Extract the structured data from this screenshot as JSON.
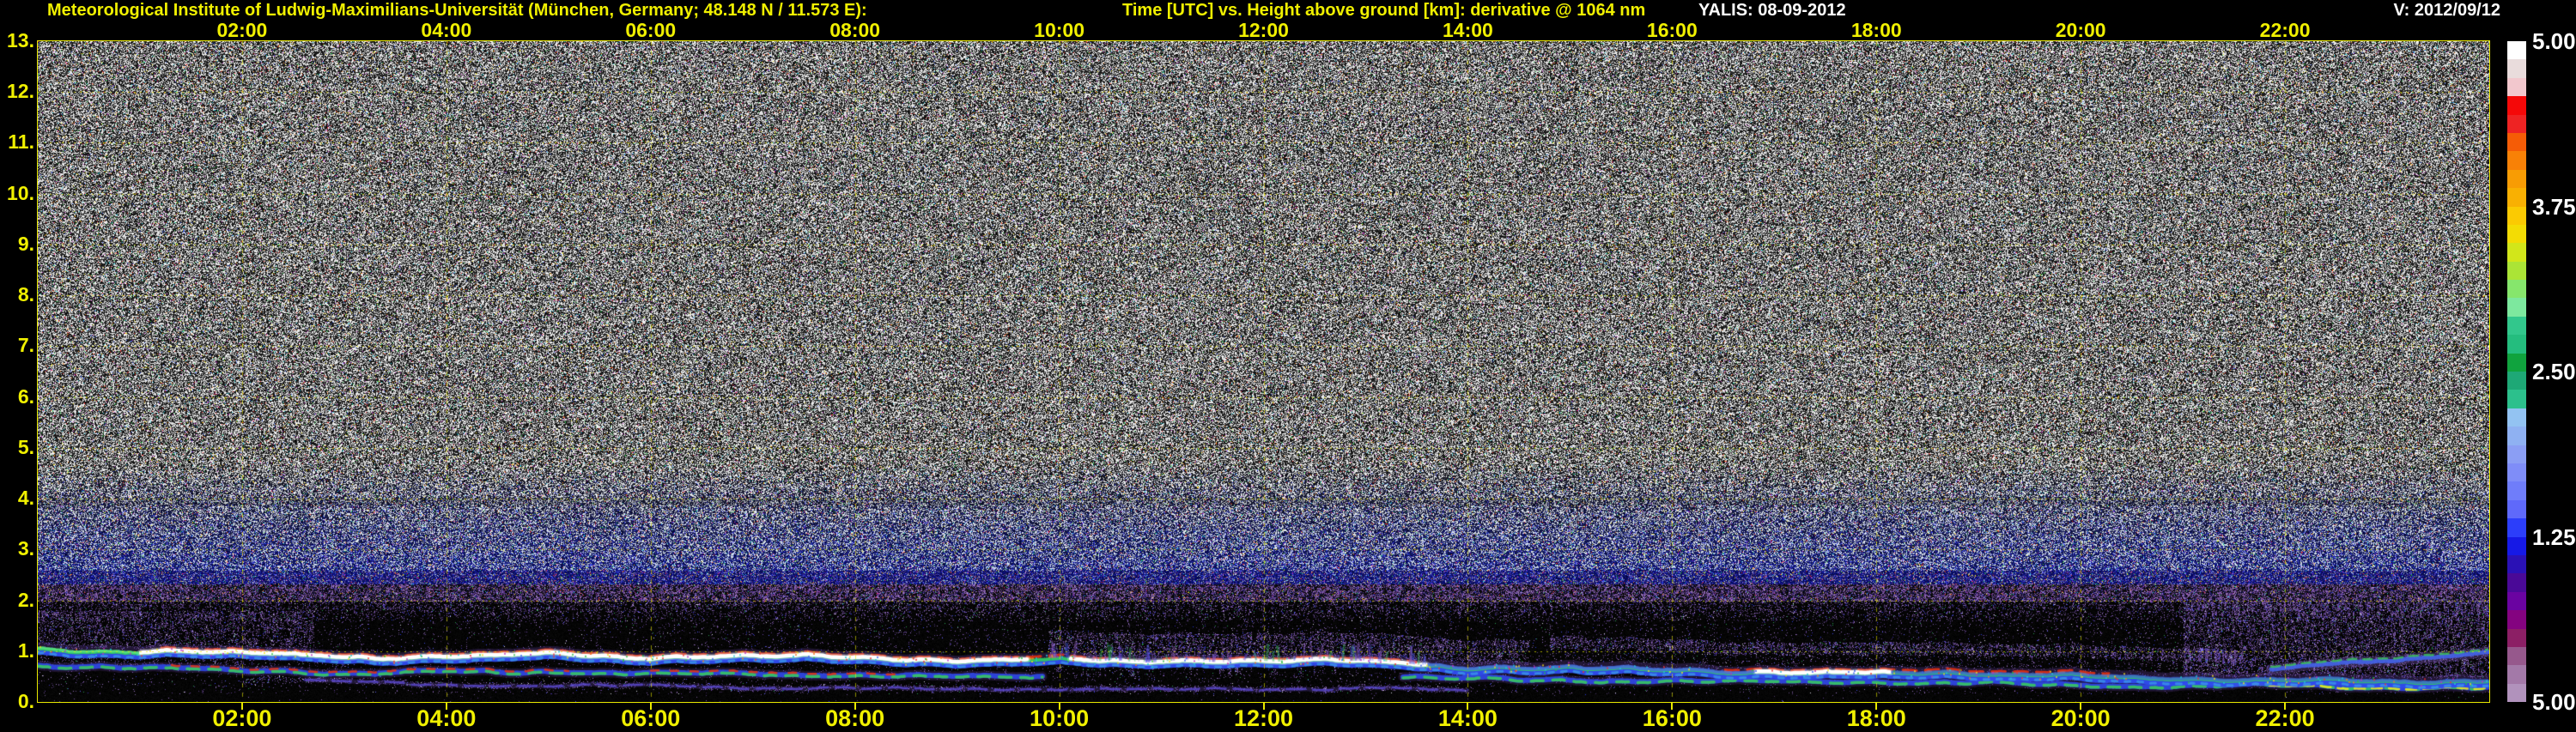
{
  "header": {
    "left_title": "Meteorological Institute of Ludwig-Maximilians-Universität (München, Germany; 48.148 N / 11.573 E):",
    "center_title": "Time [UTC] vs. Height above ground [km]: derivative @ 1064 nm",
    "system_date": "YALIS: 08-09-2012",
    "version": "V: 2012/09/12",
    "title_color": "#f0f000",
    "info_color": "#ffffff"
  },
  "axes": {
    "time_tick_hours": [
      2,
      4,
      6,
      8,
      10,
      12,
      14,
      16,
      18,
      20,
      22
    ],
    "time_tick_labels": [
      "02:00",
      "04:00",
      "06:00",
      "08:00",
      "10:00",
      "12:00",
      "14:00",
      "16:00",
      "18:00",
      "20:00",
      "22:00"
    ],
    "height_tick_values": [
      0,
      1,
      2,
      3,
      4,
      5,
      6,
      7,
      8,
      9,
      10,
      11,
      12,
      13
    ],
    "height_tick_labels": [
      "0.",
      "1.",
      "2.",
      "3.",
      "4.",
      "5.",
      "6.",
      "7.",
      "8.",
      "9.",
      "10.",
      "11.",
      "12.",
      "13."
    ],
    "axis_color": "#e8e800"
  },
  "colorbar": {
    "tick_labels": [
      "5.00",
      "3.75",
      "2.50",
      "1.25",
      "5.00"
    ],
    "tick_fractions": [
      0,
      0.25,
      0.5,
      0.75,
      1
    ],
    "label_color": "#ffffff",
    "colors": [
      "#ffffff",
      "#e9dcdc",
      "#f2c7cd",
      "#f50808",
      "#ee2323",
      "#f55c06",
      "#f88106",
      "#f89c04",
      "#f9b002",
      "#fbca02",
      "#f3dc04",
      "#d2e61a",
      "#abe436",
      "#86e66c",
      "#7de89e",
      "#32c78c",
      "#24bd7e",
      "#10a33e",
      "#1ea876",
      "#2cc08c",
      "#93c3f2",
      "#8fb1f2",
      "#8b9ef4",
      "#7f8df8",
      "#6f7dfa",
      "#5f69fa",
      "#2c3efa",
      "#1619e6",
      "#2a11b5",
      "#4a0997",
      "#6a03a1",
      "#840380",
      "#8c1f65",
      "#96588c",
      "#a379a8",
      "#b192bc"
    ]
  },
  "chart_data": {
    "type": "heatmap",
    "title": "Time [UTC] vs. Height above ground [km]: derivative @ 1064 nm",
    "station": "YALIS: 08-09-2012",
    "xlabel": "Time [UTC]",
    "ylabel": "Height above ground [km]",
    "x_range_hours": [
      0,
      24
    ],
    "y_range_km": [
      0,
      13
    ],
    "x_gridline_hours": [
      2,
      4,
      6,
      8,
      10,
      12,
      14,
      16,
      18,
      20,
      22
    ],
    "y_gridline_km": [
      1,
      2,
      3,
      4,
      5,
      6,
      7,
      8,
      9,
      10,
      11,
      12
    ],
    "colorbar_tick_labels": [
      "5.00",
      "3.75",
      "2.50",
      "1.25",
      "5.00"
    ],
    "description": "Lidar quicklook of range-corrected signal derivative at 1064 nm. Uncorrelated black/white speckle noise fills the free troposphere above ~2.6 km, gaining a blue tint below ~4.7 km. A purple noise band lies at 1.98-2.32 km. Below it, sparse purple speckles overlay black sky, with a bright multicoloured boundary-layer top band (blue/green fringes, red upper fringe, white core) undulating near 1 km in the morning and sinking to ~0.45 km by night, a second aerosol layer below it, a faint thin layer near 0.3 km, fall streaks around midday, detached purple haze layers in the evening and a rising blue layer after 22:00.",
    "features": {
      "noise_field": {
        "top_km": 13,
        "bottom_km": 2.6,
        "bright_fraction": 0.43,
        "color_speck_fraction": 0.045,
        "blue_tint_top_km": 4.7
      },
      "fade_zone_km": [
        2.32,
        2.6
      ],
      "purple_band_km": [
        1.98,
        2.32
      ],
      "dark_streak_km": 3.95,
      "boundary_layer_top": {
        "white_segments_h": [
          [
            1.0,
            9.7
          ],
          [
            10.1,
            13.6
          ],
          [
            16.8,
            18.15
          ]
        ],
        "red_fringe_h": [
          [
            1.2,
            10.5
          ],
          [
            11.0,
            13.5
          ],
          [
            16.5,
            20.3
          ]
        ],
        "points": [
          [
            0,
            1.03
          ],
          [
            0.7,
            0.99
          ],
          [
            1.5,
            1.0
          ],
          [
            2,
            0.95
          ],
          [
            2.7,
            0.89
          ],
          [
            3.5,
            0.88
          ],
          [
            4.2,
            0.91
          ],
          [
            5,
            0.93
          ],
          [
            5.7,
            0.89
          ],
          [
            6.5,
            0.91
          ],
          [
            7.2,
            0.88
          ],
          [
            8,
            0.86
          ],
          [
            8.7,
            0.84
          ],
          [
            9.5,
            0.83
          ],
          [
            10,
            0.84
          ],
          [
            10.7,
            0.8
          ],
          [
            11.3,
            0.83
          ],
          [
            12,
            0.8
          ],
          [
            12.7,
            0.82
          ],
          [
            13.3,
            0.79
          ],
          [
            14,
            0.68
          ],
          [
            14.7,
            0.66
          ],
          [
            15.3,
            0.68
          ],
          [
            16,
            0.66
          ],
          [
            16.7,
            0.6
          ],
          [
            17.3,
            0.55
          ],
          [
            18,
            0.57
          ],
          [
            18.7,
            0.6
          ],
          [
            19.3,
            0.56
          ],
          [
            20,
            0.53
          ],
          [
            20.7,
            0.5
          ],
          [
            21.3,
            0.48
          ],
          [
            22,
            0.45
          ],
          [
            22.7,
            0.42
          ],
          [
            23.3,
            0.41
          ],
          [
            24,
            0.44
          ]
        ]
      },
      "second_layer": {
        "gap_h": [
          9.85,
          13.35
        ],
        "red_dash_h": [
          [
            1.3,
            5.2
          ],
          [
            6.0,
            8.5
          ]
        ],
        "yellow_dash_h": [
          [
            21.5,
            24
          ]
        ],
        "points": [
          [
            0,
            0.72
          ],
          [
            1,
            0.67
          ],
          [
            2,
            0.63
          ],
          [
            3,
            0.58
          ],
          [
            4,
            0.58
          ],
          [
            5,
            0.6
          ],
          [
            6,
            0.58
          ],
          [
            7,
            0.56
          ],
          [
            8,
            0.54
          ],
          [
            9,
            0.5
          ],
          [
            9.85,
            0.48
          ],
          [
            13.35,
            0.48
          ],
          [
            14,
            0.46
          ],
          [
            15,
            0.44
          ],
          [
            16,
            0.42
          ],
          [
            17,
            0.4
          ],
          [
            18,
            0.38
          ],
          [
            19,
            0.36
          ],
          [
            20,
            0.34
          ],
          [
            21,
            0.32
          ],
          [
            22,
            0.3
          ],
          [
            23,
            0.28
          ],
          [
            24,
            0.28
          ]
        ]
      },
      "thin_layer": {
        "h_range": [
          2.6,
          14
        ],
        "points": [
          [
            2.6,
            0.42
          ],
          [
            3.5,
            0.36
          ],
          [
            4,
            0.33
          ],
          [
            5,
            0.3
          ],
          [
            6,
            0.33
          ],
          [
            7,
            0.3
          ],
          [
            8,
            0.28
          ],
          [
            9,
            0.26
          ],
          [
            10,
            0.25
          ],
          [
            11,
            0.27
          ],
          [
            12,
            0.25
          ],
          [
            13,
            0.26
          ],
          [
            14,
            0.24
          ]
        ]
      },
      "rising_layer": {
        "h_range": [
          21.85,
          24
        ],
        "km_start": 0.62,
        "km_end": 0.97
      },
      "upper_haze": {
        "h_range": [
          14.8,
          21.6
        ],
        "offset_km": [
          0.35,
          0.6
        ]
      },
      "morning_blob": {
        "h_range": [
          0,
          2.7
        ],
        "km_max": 1.8
      },
      "evening_dense": {
        "h_range": [
          21,
          24
        ],
        "km_max": 2.15
      },
      "fall_streaks_h": [
        9.9,
        14.6
      ],
      "spike_region": {
        "h_range": [
          9.9,
          13.6
        ],
        "count": 90,
        "max_rise_km": 0.3
      }
    }
  }
}
